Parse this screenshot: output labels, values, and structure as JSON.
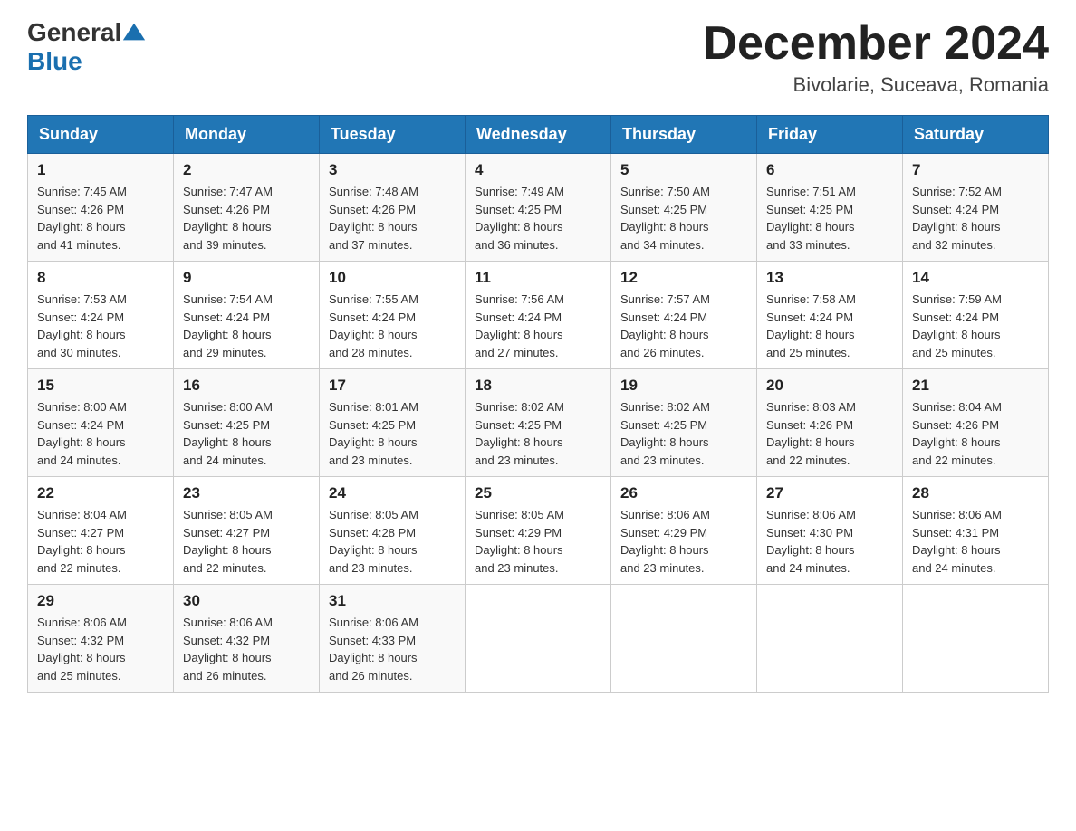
{
  "logo": {
    "general": "General",
    "blue": "Blue"
  },
  "title": "December 2024",
  "location": "Bivolarie, Suceava, Romania",
  "days_of_week": [
    "Sunday",
    "Monday",
    "Tuesday",
    "Wednesday",
    "Thursday",
    "Friday",
    "Saturday"
  ],
  "weeks": [
    [
      {
        "day": "1",
        "sunrise": "7:45 AM",
        "sunset": "4:26 PM",
        "daylight": "8 hours and 41 minutes."
      },
      {
        "day": "2",
        "sunrise": "7:47 AM",
        "sunset": "4:26 PM",
        "daylight": "8 hours and 39 minutes."
      },
      {
        "day": "3",
        "sunrise": "7:48 AM",
        "sunset": "4:26 PM",
        "daylight": "8 hours and 37 minutes."
      },
      {
        "day": "4",
        "sunrise": "7:49 AM",
        "sunset": "4:25 PM",
        "daylight": "8 hours and 36 minutes."
      },
      {
        "day": "5",
        "sunrise": "7:50 AM",
        "sunset": "4:25 PM",
        "daylight": "8 hours and 34 minutes."
      },
      {
        "day": "6",
        "sunrise": "7:51 AM",
        "sunset": "4:25 PM",
        "daylight": "8 hours and 33 minutes."
      },
      {
        "day": "7",
        "sunrise": "7:52 AM",
        "sunset": "4:24 PM",
        "daylight": "8 hours and 32 minutes."
      }
    ],
    [
      {
        "day": "8",
        "sunrise": "7:53 AM",
        "sunset": "4:24 PM",
        "daylight": "8 hours and 30 minutes."
      },
      {
        "day": "9",
        "sunrise": "7:54 AM",
        "sunset": "4:24 PM",
        "daylight": "8 hours and 29 minutes."
      },
      {
        "day": "10",
        "sunrise": "7:55 AM",
        "sunset": "4:24 PM",
        "daylight": "8 hours and 28 minutes."
      },
      {
        "day": "11",
        "sunrise": "7:56 AM",
        "sunset": "4:24 PM",
        "daylight": "8 hours and 27 minutes."
      },
      {
        "day": "12",
        "sunrise": "7:57 AM",
        "sunset": "4:24 PM",
        "daylight": "8 hours and 26 minutes."
      },
      {
        "day": "13",
        "sunrise": "7:58 AM",
        "sunset": "4:24 PM",
        "daylight": "8 hours and 25 minutes."
      },
      {
        "day": "14",
        "sunrise": "7:59 AM",
        "sunset": "4:24 PM",
        "daylight": "8 hours and 25 minutes."
      }
    ],
    [
      {
        "day": "15",
        "sunrise": "8:00 AM",
        "sunset": "4:24 PM",
        "daylight": "8 hours and 24 minutes."
      },
      {
        "day": "16",
        "sunrise": "8:00 AM",
        "sunset": "4:25 PM",
        "daylight": "8 hours and 24 minutes."
      },
      {
        "day": "17",
        "sunrise": "8:01 AM",
        "sunset": "4:25 PM",
        "daylight": "8 hours and 23 minutes."
      },
      {
        "day": "18",
        "sunrise": "8:02 AM",
        "sunset": "4:25 PM",
        "daylight": "8 hours and 23 minutes."
      },
      {
        "day": "19",
        "sunrise": "8:02 AM",
        "sunset": "4:25 PM",
        "daylight": "8 hours and 23 minutes."
      },
      {
        "day": "20",
        "sunrise": "8:03 AM",
        "sunset": "4:26 PM",
        "daylight": "8 hours and 22 minutes."
      },
      {
        "day": "21",
        "sunrise": "8:04 AM",
        "sunset": "4:26 PM",
        "daylight": "8 hours and 22 minutes."
      }
    ],
    [
      {
        "day": "22",
        "sunrise": "8:04 AM",
        "sunset": "4:27 PM",
        "daylight": "8 hours and 22 minutes."
      },
      {
        "day": "23",
        "sunrise": "8:05 AM",
        "sunset": "4:27 PM",
        "daylight": "8 hours and 22 minutes."
      },
      {
        "day": "24",
        "sunrise": "8:05 AM",
        "sunset": "4:28 PM",
        "daylight": "8 hours and 23 minutes."
      },
      {
        "day": "25",
        "sunrise": "8:05 AM",
        "sunset": "4:29 PM",
        "daylight": "8 hours and 23 minutes."
      },
      {
        "day": "26",
        "sunrise": "8:06 AM",
        "sunset": "4:29 PM",
        "daylight": "8 hours and 23 minutes."
      },
      {
        "day": "27",
        "sunrise": "8:06 AM",
        "sunset": "4:30 PM",
        "daylight": "8 hours and 24 minutes."
      },
      {
        "day": "28",
        "sunrise": "8:06 AM",
        "sunset": "4:31 PM",
        "daylight": "8 hours and 24 minutes."
      }
    ],
    [
      {
        "day": "29",
        "sunrise": "8:06 AM",
        "sunset": "4:32 PM",
        "daylight": "8 hours and 25 minutes."
      },
      {
        "day": "30",
        "sunrise": "8:06 AM",
        "sunset": "4:32 PM",
        "daylight": "8 hours and 26 minutes."
      },
      {
        "day": "31",
        "sunrise": "8:06 AM",
        "sunset": "4:33 PM",
        "daylight": "8 hours and 26 minutes."
      },
      null,
      null,
      null,
      null
    ]
  ],
  "labels": {
    "sunrise": "Sunrise:",
    "sunset": "Sunset:",
    "daylight": "Daylight:"
  }
}
